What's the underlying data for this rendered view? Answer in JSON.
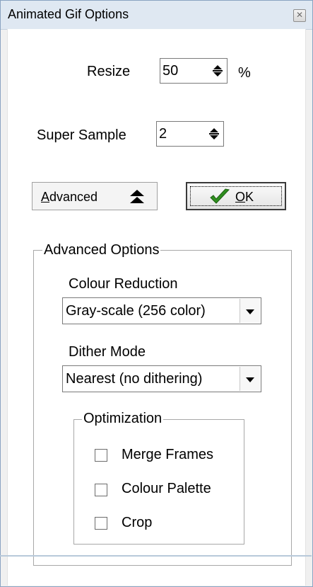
{
  "window": {
    "title": "Animated Gif Options",
    "close_icon": "close-icon"
  },
  "resize": {
    "label": "Resize",
    "value": "50",
    "unit": "%"
  },
  "super_sample": {
    "label": "Super Sample",
    "value": "2"
  },
  "buttons": {
    "advanced_label_first": "A",
    "advanced_label_rest": "dvanced",
    "advanced_icon": "double-chevron-up-icon",
    "ok_label_first": "O",
    "ok_label_rest": "K",
    "ok_icon": "checkmark-icon"
  },
  "advanced_options": {
    "legend": "Advanced Options",
    "colour_reduction": {
      "label": "Colour Reduction",
      "value": "Gray-scale (256 color)"
    },
    "dither_mode": {
      "label": "Dither Mode",
      "value": "Nearest (no dithering)"
    },
    "optimization": {
      "legend": "Optimization",
      "items": [
        {
          "label": "Merge Frames",
          "checked": false
        },
        {
          "label": "Colour Palette",
          "checked": false
        },
        {
          "label": "Crop",
          "checked": false
        }
      ]
    }
  },
  "colors": {
    "titlebar": "#dfe8f2",
    "ok_check": "#2f8f1f"
  }
}
